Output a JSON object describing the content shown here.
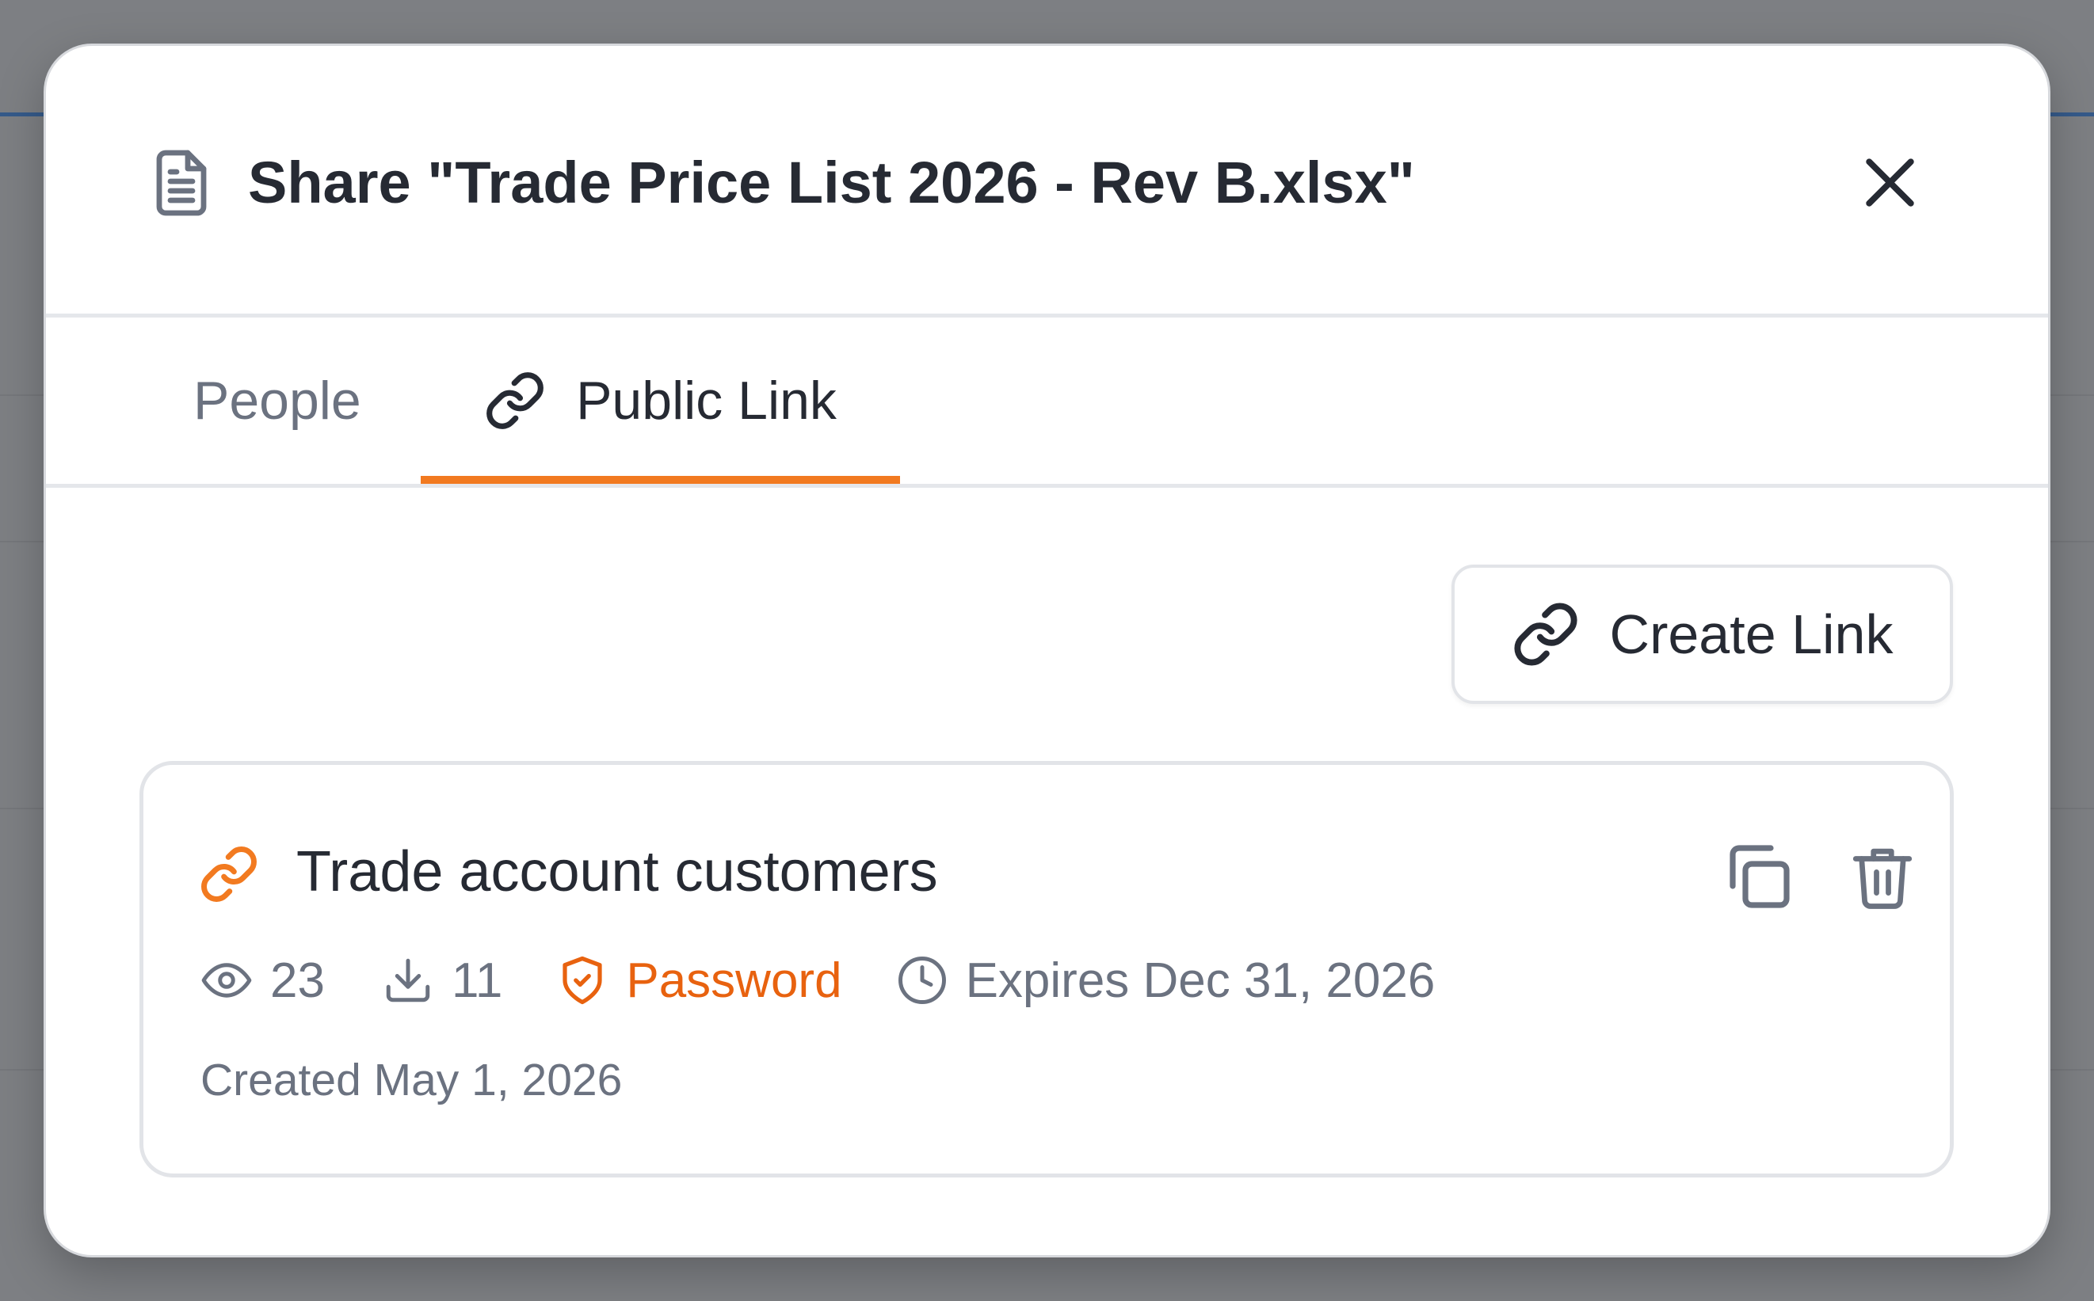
{
  "dialog": {
    "title": "Share \"Trade Price List 2026 - Rev B.xlsx\"",
    "file_icon": "document-icon",
    "close_icon": "close-icon"
  },
  "tabs": [
    {
      "label": "People",
      "active": false
    },
    {
      "label": "Public Link",
      "active": true,
      "icon": "link-icon"
    }
  ],
  "actions": {
    "create_link_label": "Create Link",
    "create_link_icon": "link-icon"
  },
  "links": [
    {
      "name": "Trade account customers",
      "icon": "link-icon",
      "views": "23",
      "downloads": "11",
      "protection": "Password",
      "expires": "Expires Dec 31, 2026",
      "created": "Created May 1, 2026",
      "copy_icon": "copy-icon",
      "delete_icon": "trash-icon"
    }
  ],
  "colors": {
    "accent": "#f27a20",
    "password": "#e8620f",
    "text_primary": "#262a33",
    "text_secondary": "#6b7280",
    "overlay": "#7d7f83"
  }
}
